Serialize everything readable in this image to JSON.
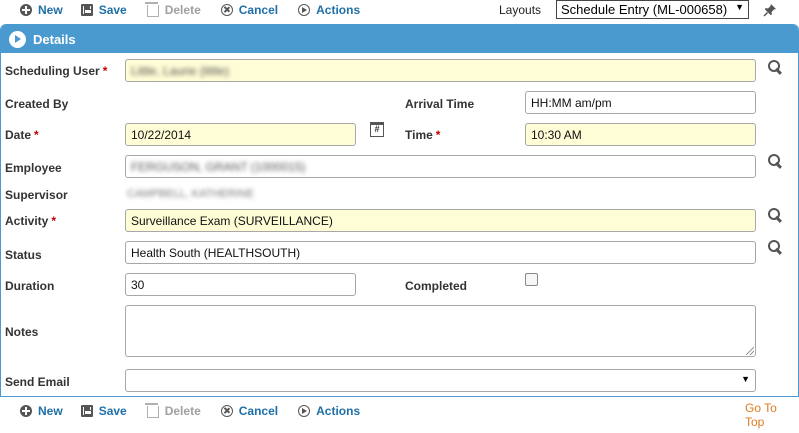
{
  "toolbar": {
    "new_label": "New",
    "save_label": "Save",
    "delete_label": "Delete",
    "cancel_label": "Cancel",
    "actions_label": "Actions"
  },
  "layouts": {
    "label": "Layouts",
    "selected": "Schedule Entry (ML-000658)"
  },
  "panel": {
    "title": "Details"
  },
  "form": {
    "scheduling_user": {
      "label": "Scheduling User",
      "required": "*",
      "value": "Little, Laurie (little)"
    },
    "created_by": {
      "label": "Created By"
    },
    "arrival_time": {
      "label": "Arrival Time",
      "placeholder": "HH:MM am/pm"
    },
    "date": {
      "label": "Date",
      "required": "*",
      "value": "10/22/2014"
    },
    "time": {
      "label": "Time",
      "required": "*",
      "value": "10:30 AM"
    },
    "employee": {
      "label": "Employee",
      "value": "FERGUSON, GRANT (1000015)"
    },
    "supervisor": {
      "label": "Supervisor",
      "value": "CAMPBELL, KATHERINE"
    },
    "activity": {
      "label": "Activity",
      "required": "*",
      "value": "Surveillance Exam (SURVEILLANCE)"
    },
    "status": {
      "label": "Status",
      "value": "Health South (HEALTHSOUTH)"
    },
    "duration": {
      "label": "Duration",
      "value": "30"
    },
    "completed": {
      "label": "Completed"
    },
    "notes": {
      "label": "Notes"
    },
    "send_email": {
      "label": "Send Email",
      "value": ""
    }
  },
  "footer": {
    "goto_top": "Go To Top"
  },
  "icons": {
    "new": "plus-circle-icon",
    "save": "floppy-disk-icon",
    "delete": "trash-icon",
    "cancel": "x-circle-icon",
    "actions": "play-circle-icon",
    "pin": "pin-icon",
    "lookup": "search-icon",
    "calendar": "calendar-icon"
  },
  "colors": {
    "accent": "#4a9ad0",
    "link": "#1f6fa8",
    "required": "#c00000",
    "highlight_field": "#fefdd6",
    "goto_top": "#e07a1f"
  }
}
